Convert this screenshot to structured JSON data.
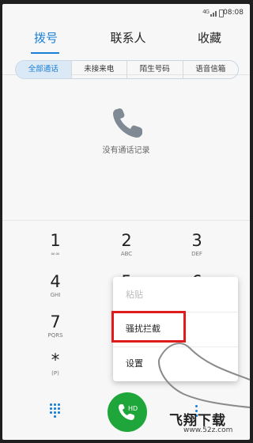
{
  "status_bar": {
    "signal_label": "4G",
    "time": "08:08"
  },
  "tabs": [
    {
      "label": "拨号"
    },
    {
      "label": "联系人"
    },
    {
      "label": "收藏"
    }
  ],
  "filters": [
    {
      "label": "全部通话"
    },
    {
      "label": "未接来电"
    },
    {
      "label": "陌生号码"
    },
    {
      "label": "语音信箱"
    }
  ],
  "empty_state": {
    "text": "没有通话记录"
  },
  "keypad": [
    {
      "digit": "1",
      "letters": "∞∞"
    },
    {
      "digit": "2",
      "letters": "ABC"
    },
    {
      "digit": "3",
      "letters": "DEF"
    },
    {
      "digit": "4",
      "letters": "GHI"
    },
    {
      "digit": "5",
      "letters": ""
    },
    {
      "digit": "6",
      "letters": ""
    },
    {
      "digit": "7",
      "letters": "PQRS"
    },
    {
      "digit": "*",
      "letters": "(P)"
    }
  ],
  "menu": {
    "items": [
      {
        "label": "粘贴"
      },
      {
        "label": "骚扰拦截"
      },
      {
        "label": "设置"
      }
    ]
  },
  "call_button": {
    "label": "HD"
  },
  "watermark": {
    "text": "飞翔下载",
    "url": "www.52z.com"
  },
  "colors": {
    "accent": "#1a7fd6",
    "call_green": "#1fa63a",
    "highlight_red": "#e01b1b"
  }
}
